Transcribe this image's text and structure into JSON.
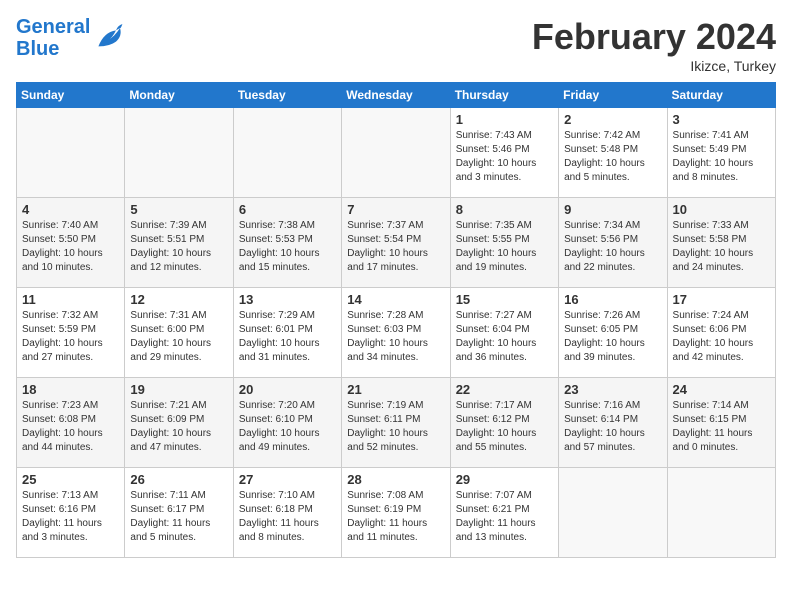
{
  "header": {
    "logo_line1": "General",
    "logo_line2": "Blue",
    "month": "February 2024",
    "location": "Ikizce, Turkey"
  },
  "weekdays": [
    "Sunday",
    "Monday",
    "Tuesday",
    "Wednesday",
    "Thursday",
    "Friday",
    "Saturday"
  ],
  "weeks": [
    [
      {
        "day": "",
        "info": ""
      },
      {
        "day": "",
        "info": ""
      },
      {
        "day": "",
        "info": ""
      },
      {
        "day": "",
        "info": ""
      },
      {
        "day": "1",
        "info": "Sunrise: 7:43 AM\nSunset: 5:46 PM\nDaylight: 10 hours\nand 3 minutes."
      },
      {
        "day": "2",
        "info": "Sunrise: 7:42 AM\nSunset: 5:48 PM\nDaylight: 10 hours\nand 5 minutes."
      },
      {
        "day": "3",
        "info": "Sunrise: 7:41 AM\nSunset: 5:49 PM\nDaylight: 10 hours\nand 8 minutes."
      }
    ],
    [
      {
        "day": "4",
        "info": "Sunrise: 7:40 AM\nSunset: 5:50 PM\nDaylight: 10 hours\nand 10 minutes."
      },
      {
        "day": "5",
        "info": "Sunrise: 7:39 AM\nSunset: 5:51 PM\nDaylight: 10 hours\nand 12 minutes."
      },
      {
        "day": "6",
        "info": "Sunrise: 7:38 AM\nSunset: 5:53 PM\nDaylight: 10 hours\nand 15 minutes."
      },
      {
        "day": "7",
        "info": "Sunrise: 7:37 AM\nSunset: 5:54 PM\nDaylight: 10 hours\nand 17 minutes."
      },
      {
        "day": "8",
        "info": "Sunrise: 7:35 AM\nSunset: 5:55 PM\nDaylight: 10 hours\nand 19 minutes."
      },
      {
        "day": "9",
        "info": "Sunrise: 7:34 AM\nSunset: 5:56 PM\nDaylight: 10 hours\nand 22 minutes."
      },
      {
        "day": "10",
        "info": "Sunrise: 7:33 AM\nSunset: 5:58 PM\nDaylight: 10 hours\nand 24 minutes."
      }
    ],
    [
      {
        "day": "11",
        "info": "Sunrise: 7:32 AM\nSunset: 5:59 PM\nDaylight: 10 hours\nand 27 minutes."
      },
      {
        "day": "12",
        "info": "Sunrise: 7:31 AM\nSunset: 6:00 PM\nDaylight: 10 hours\nand 29 minutes."
      },
      {
        "day": "13",
        "info": "Sunrise: 7:29 AM\nSunset: 6:01 PM\nDaylight: 10 hours\nand 31 minutes."
      },
      {
        "day": "14",
        "info": "Sunrise: 7:28 AM\nSunset: 6:03 PM\nDaylight: 10 hours\nand 34 minutes."
      },
      {
        "day": "15",
        "info": "Sunrise: 7:27 AM\nSunset: 6:04 PM\nDaylight: 10 hours\nand 36 minutes."
      },
      {
        "day": "16",
        "info": "Sunrise: 7:26 AM\nSunset: 6:05 PM\nDaylight: 10 hours\nand 39 minutes."
      },
      {
        "day": "17",
        "info": "Sunrise: 7:24 AM\nSunset: 6:06 PM\nDaylight: 10 hours\nand 42 minutes."
      }
    ],
    [
      {
        "day": "18",
        "info": "Sunrise: 7:23 AM\nSunset: 6:08 PM\nDaylight: 10 hours\nand 44 minutes."
      },
      {
        "day": "19",
        "info": "Sunrise: 7:21 AM\nSunset: 6:09 PM\nDaylight: 10 hours\nand 47 minutes."
      },
      {
        "day": "20",
        "info": "Sunrise: 7:20 AM\nSunset: 6:10 PM\nDaylight: 10 hours\nand 49 minutes."
      },
      {
        "day": "21",
        "info": "Sunrise: 7:19 AM\nSunset: 6:11 PM\nDaylight: 10 hours\nand 52 minutes."
      },
      {
        "day": "22",
        "info": "Sunrise: 7:17 AM\nSunset: 6:12 PM\nDaylight: 10 hours\nand 55 minutes."
      },
      {
        "day": "23",
        "info": "Sunrise: 7:16 AM\nSunset: 6:14 PM\nDaylight: 10 hours\nand 57 minutes."
      },
      {
        "day": "24",
        "info": "Sunrise: 7:14 AM\nSunset: 6:15 PM\nDaylight: 11 hours\nand 0 minutes."
      }
    ],
    [
      {
        "day": "25",
        "info": "Sunrise: 7:13 AM\nSunset: 6:16 PM\nDaylight: 11 hours\nand 3 minutes."
      },
      {
        "day": "26",
        "info": "Sunrise: 7:11 AM\nSunset: 6:17 PM\nDaylight: 11 hours\nand 5 minutes."
      },
      {
        "day": "27",
        "info": "Sunrise: 7:10 AM\nSunset: 6:18 PM\nDaylight: 11 hours\nand 8 minutes."
      },
      {
        "day": "28",
        "info": "Sunrise: 7:08 AM\nSunset: 6:19 PM\nDaylight: 11 hours\nand 11 minutes."
      },
      {
        "day": "29",
        "info": "Sunrise: 7:07 AM\nSunset: 6:21 PM\nDaylight: 11 hours\nand 13 minutes."
      },
      {
        "day": "",
        "info": ""
      },
      {
        "day": "",
        "info": ""
      }
    ]
  ]
}
